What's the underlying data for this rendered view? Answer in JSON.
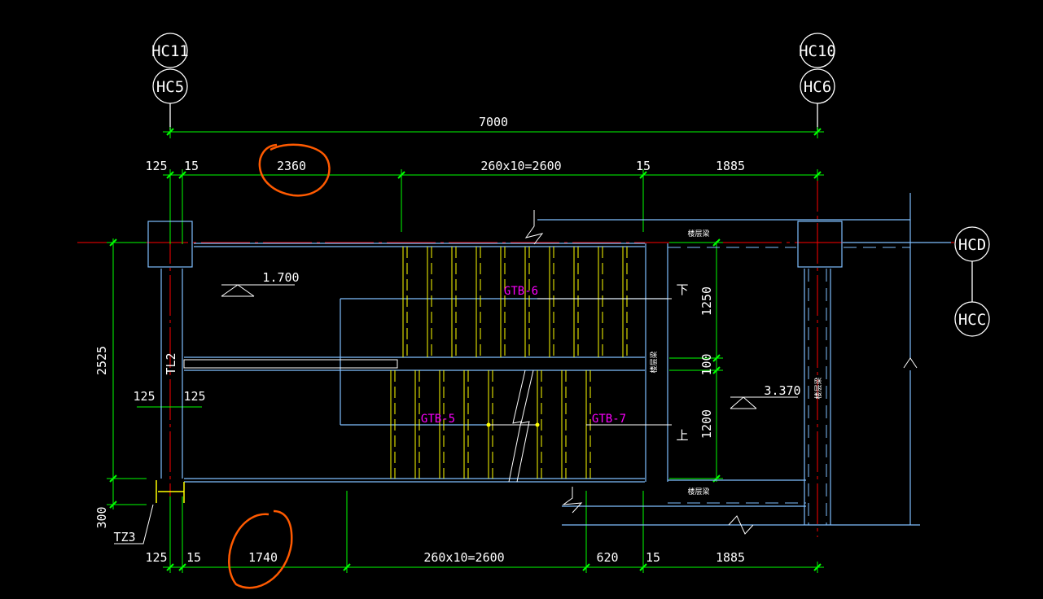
{
  "axes": {
    "left_top": "HC11",
    "left_bottom": "HC5",
    "right_top": "HC10",
    "right_bottom": "HC6",
    "side_top": "HCD",
    "side_bottom": "HCC"
  },
  "dims_top": {
    "overall": "7000",
    "seg1": "125",
    "seg2": "15",
    "seg3": "2360",
    "seg4": "260x10=2600",
    "seg5": "15",
    "seg6": "1885"
  },
  "dims_bottom": {
    "seg1": "125",
    "seg2": "15",
    "seg3": "1740",
    "seg4": "260x10=2600",
    "seg5": "620",
    "seg6": "15",
    "seg7": "1885"
  },
  "dims_left": {
    "d1": "2525",
    "d2": "300",
    "w1": "125",
    "w2": "125"
  },
  "dims_right": {
    "d1": "1250",
    "d2": "100",
    "d3": "1200"
  },
  "elevations": {
    "left": "1.700",
    "right": "3.370"
  },
  "labels": {
    "tl": "TL2",
    "tz": "TZ3",
    "down": "下",
    "up": "上",
    "floor_beam": "楼层梁"
  },
  "flights": {
    "upper": "GTB-6",
    "lower_left": "GTB-5",
    "lower_right": "GTB-7"
  },
  "colors": {
    "background": "#000000",
    "dimension": "#00ff00",
    "wall": "#7fbfff",
    "axis": "#ff0000",
    "tread": "#ffff00",
    "text": "#ffffff",
    "flight_label": "#ff00ff",
    "markup": "#ff5a00"
  }
}
